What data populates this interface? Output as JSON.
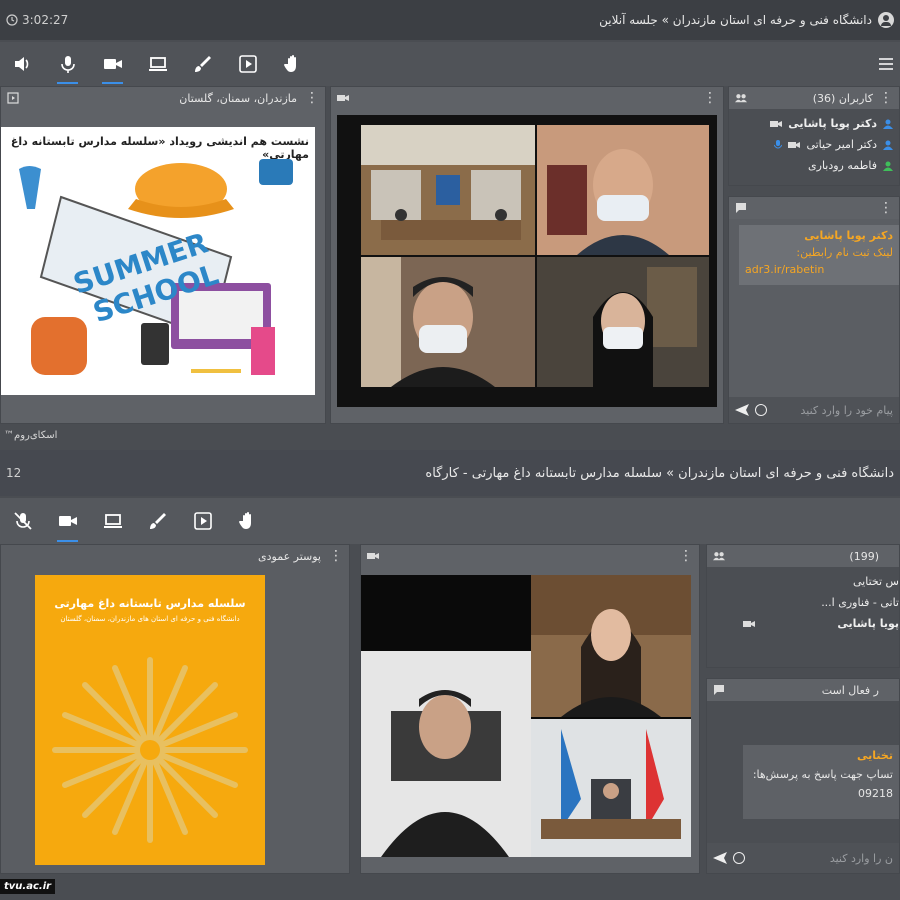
{
  "colors": {
    "accent": "#3b8fe8",
    "chat_name": "#f5a623",
    "chat_link": "#f5a623",
    "presence_green": "#3fbf5a"
  },
  "top": {
    "timer": "3:02:27",
    "title": "دانشگاه فنی و حرفه ای استان مازندران » جلسه آنلاین",
    "toolbar_icons": [
      "speaker-icon",
      "mic-icon",
      "camera-icon",
      "screen-share-icon",
      "brush-icon",
      "media-icon",
      "raise-hand-icon"
    ],
    "presentation": {
      "title": "مازندران، سمنان، گلستان",
      "slide_heading": "نشست هم اندیشی رویداد «سلسله مدارس تابستانه داغ مهارتی»",
      "slide_text1": "SUMMER",
      "slide_text2": "SCHOOL"
    },
    "users": {
      "title": "کاربران (36)",
      "list": [
        {
          "name": "دکتر پویا پاشایی",
          "bold": true,
          "mic": false,
          "cam": true,
          "color": "#3b8fe8"
        },
        {
          "name": "دکتر امیر حیاتی",
          "bold": false,
          "mic": true,
          "cam": true,
          "color": "#3b8fe8"
        },
        {
          "name": "فاطمه رودباری",
          "bold": false,
          "mic": false,
          "cam": false,
          "color": "#3fbf5a"
        }
      ]
    },
    "chat": {
      "sender": "دکتر پویا پاشایی",
      "line1": "لینک ثبت نام رابطین:",
      "line2": "adr3.ir/rabetin",
      "placeholder": "پیام خود را وارد کنید"
    },
    "footer": "اسکای‌روم™"
  },
  "bottom": {
    "timer": "12",
    "title": "دانشگاه فنی و حرفه ای استان مازندران » سلسله مدارس تابستانه داغ مهارتی - کارگاه",
    "toolbar_icons": [
      "mic-off-icon",
      "camera-icon",
      "screen-share-icon",
      "brush-icon",
      "media-icon",
      "raise-hand-icon"
    ],
    "presentation": {
      "title": "پوستر عمودی",
      "poster_title": "سلسله مدارس تابستانه داغ مهارتی",
      "poster_sub": "دانشگاه فنی و حرفه ای استان های مازندران، سمنان، گلستان"
    },
    "users": {
      "title": "(199)",
      "row1": "س تختایی",
      "row2": "تانی - فناوری ا...",
      "row3": "پویا پاشایی"
    },
    "chat": {
      "title": "ر فعال است",
      "sender": "تختایی",
      "line1": "تساپ جهت پاسخ به پرسش‌ها:",
      "line2": "09218",
      "placeholder": "ن را وارد کنید"
    },
    "logo": "tvu.ac.ir"
  }
}
